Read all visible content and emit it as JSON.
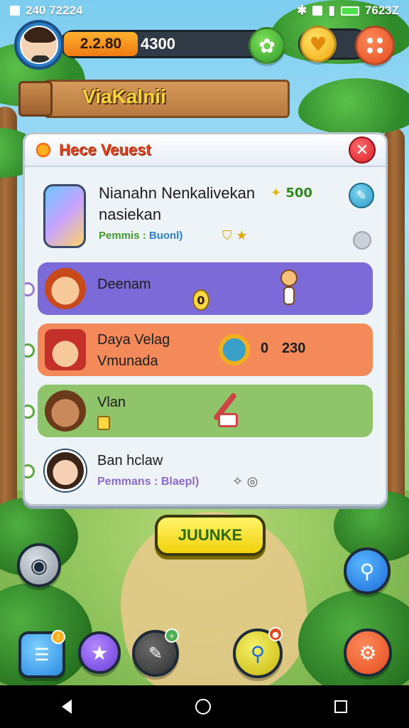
{
  "status": {
    "time": "240 72224",
    "right_time": "7623Z"
  },
  "hud": {
    "coins": "2.2.80",
    "gems": "4300"
  },
  "sign": {
    "title": "ViaKalnii"
  },
  "panel": {
    "title": "Hece Veuest",
    "close_icon": "close-icon",
    "top_item": {
      "name_line1": "Nianahn Nenkalivekan",
      "name_line2": "nasiekan",
      "reward": "500",
      "sub_a": "Pemmis :",
      "sub_b": "Buonl)"
    },
    "rows": [
      {
        "name": "Deenam",
        "value": "0"
      },
      {
        "name": "Daya Velag",
        "sub": "Vmunada",
        "value_a": "0",
        "value_b": "230"
      },
      {
        "name": "Vlan"
      },
      {
        "name": "Ban hclaw",
        "sub": "Pemmans : Blaepl)"
      }
    ]
  },
  "action": {
    "label": "JUUNKE"
  },
  "colors": {
    "purple_row": "#7c6ad8",
    "orange_row": "#f48a5a",
    "green_row": "#8fc46a",
    "action_yellow": "#f2d20a"
  }
}
